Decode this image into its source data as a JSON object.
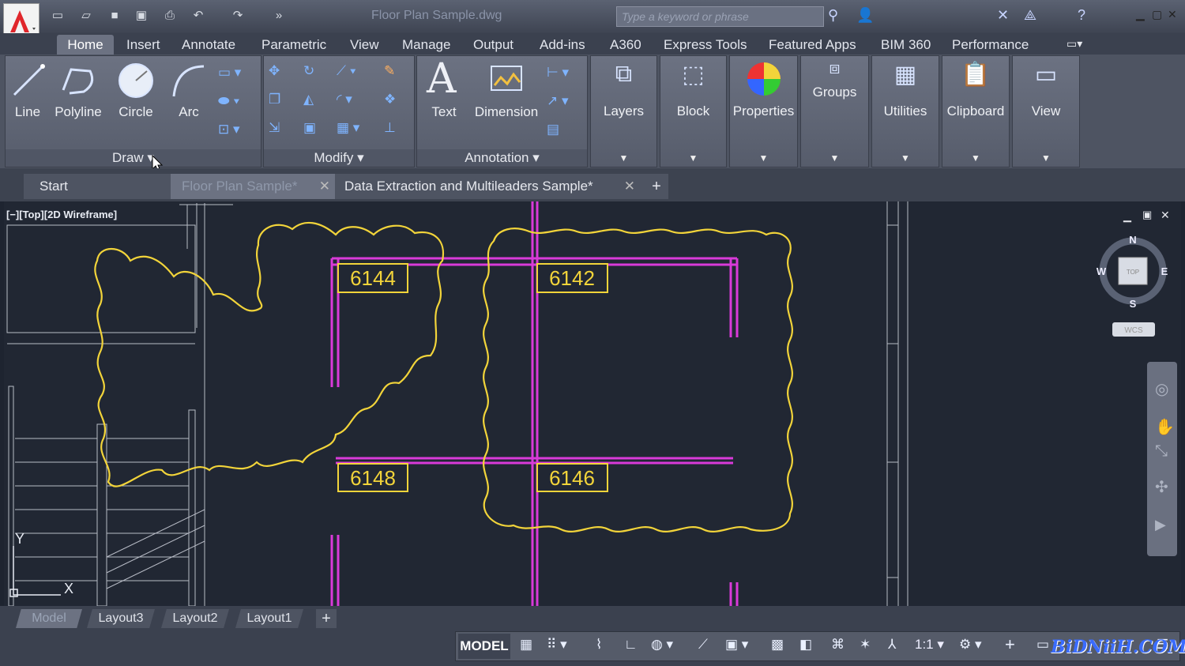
{
  "title_bar": {
    "document_title": "Floor Plan Sample.dwg",
    "search_placeholder": "Type a keyword or phrase",
    "icons": [
      "new-icon",
      "open-icon",
      "save-icon",
      "save-as-icon",
      "print-icon",
      "undo-icon",
      "redo-icon",
      "more-icon"
    ]
  },
  "ribbon_tabs": [
    "Home",
    "Insert",
    "Annotate",
    "Parametric",
    "View",
    "Manage",
    "Output",
    "Add-ins",
    "A360",
    "Express Tools",
    "Featured Apps",
    "BIM 360",
    "Performance"
  ],
  "ribbon": {
    "draw": {
      "line": "Line",
      "polyline": "Polyline",
      "circle": "Circle",
      "arc": "Arc",
      "panel": "Draw"
    },
    "modify": {
      "panel": "Modify"
    },
    "annotation": {
      "text": "Text",
      "dimension": "Dimension",
      "panel": "Annotation"
    },
    "panels": {
      "layers": "Layers",
      "block": "Block",
      "properties": "Properties",
      "groups": "Groups",
      "utilities": "Utilities",
      "clipboard": "Clipboard",
      "view": "View"
    }
  },
  "doc_tabs": {
    "start": "Start",
    "floor_plan": "Floor Plan Sample*",
    "data_extraction": "Data Extraction and Multileaders Sample*"
  },
  "viewport": {
    "label": "[−][Top][2D Wireframe]",
    "rooms": [
      "6144",
      "6142",
      "6148",
      "6146"
    ],
    "compass": {
      "n": "N",
      "s": "S",
      "e": "E",
      "w": "W",
      "top": "TOP",
      "wcs": "WCS"
    },
    "ucs": {
      "x": "X",
      "y": "Y"
    }
  },
  "layout_tabs": [
    "Model",
    "Layout3",
    "Layout2",
    "Layout1"
  ],
  "status": {
    "model": "MODEL",
    "scale": "1:1",
    "watermark": "BiDNiiH.COM"
  },
  "colors": {
    "cloud": "#f2d43a",
    "wall": "#d93ad9",
    "bg": "#212733"
  }
}
